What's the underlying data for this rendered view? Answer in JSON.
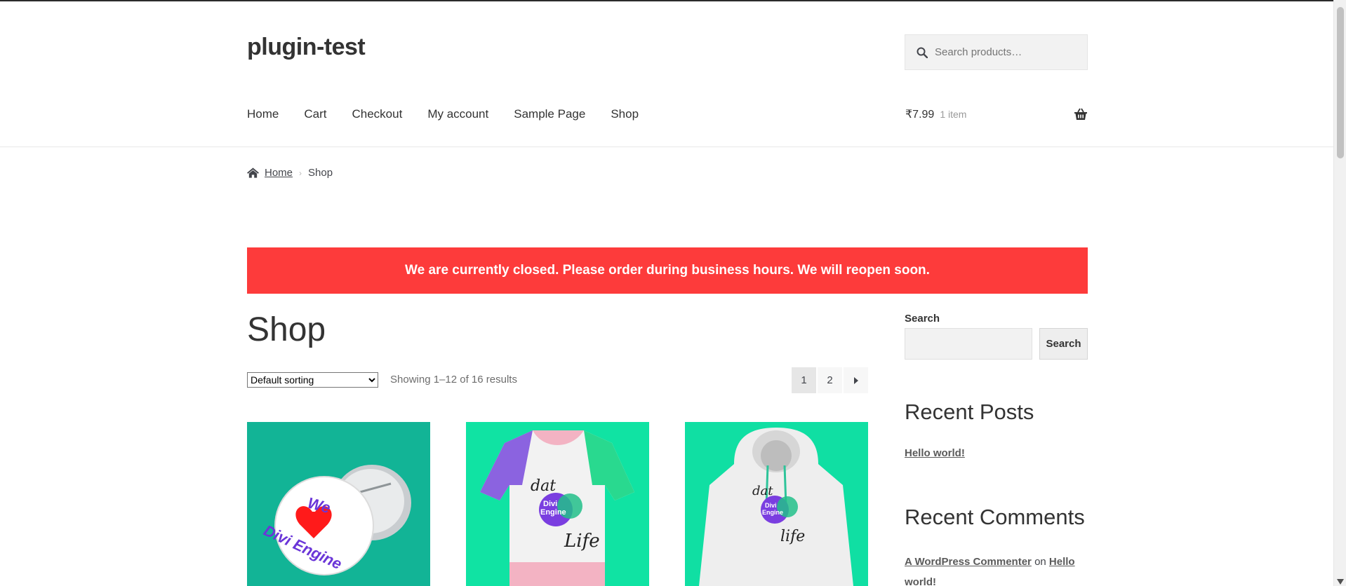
{
  "site": {
    "title": "plugin-test"
  },
  "search": {
    "placeholder": "Search products…"
  },
  "nav": {
    "items": [
      "Home",
      "Cart",
      "Checkout",
      "My account",
      "Sample Page",
      "Shop"
    ]
  },
  "cart": {
    "price": "₹7.99",
    "count": "1 item"
  },
  "breadcrumb": {
    "home": "Home",
    "current": "Shop"
  },
  "notice": {
    "text": "We are currently closed. Please order during business hours. We will reopen soon."
  },
  "main": {
    "title": "Shop",
    "sort_selected": "Default sorting",
    "result_count": "Showing 1–12 of 16 results",
    "pages": [
      "1",
      "2"
    ],
    "current_page": "1"
  },
  "products": [
    {
      "image": "we-love-divi-engine-button",
      "text_lines": [
        "We",
        "Divi Engine"
      ]
    },
    {
      "image": "dat-divi-life-tshirt",
      "text_lines": [
        "dat",
        "Divi",
        "Engine",
        "Life"
      ]
    },
    {
      "image": "dat-divi-life-hoodie",
      "text_lines": [
        "dat",
        "Divi",
        "Engine",
        "life"
      ]
    }
  ],
  "sidebar": {
    "search_label": "Search",
    "search_button": "Search",
    "recent_posts_title": "Recent Posts",
    "recent_posts": [
      "Hello world!"
    ],
    "recent_comments_title": "Recent Comments",
    "comment": {
      "author": "A WordPress Commenter",
      "on": "on",
      "post": "Hello world!"
    }
  },
  "colors": {
    "notice_bg": "#fd3b3b",
    "product1_bg": "#12b496",
    "product2_bg": "#10e3a3",
    "product3_bg": "#10dfa3"
  }
}
